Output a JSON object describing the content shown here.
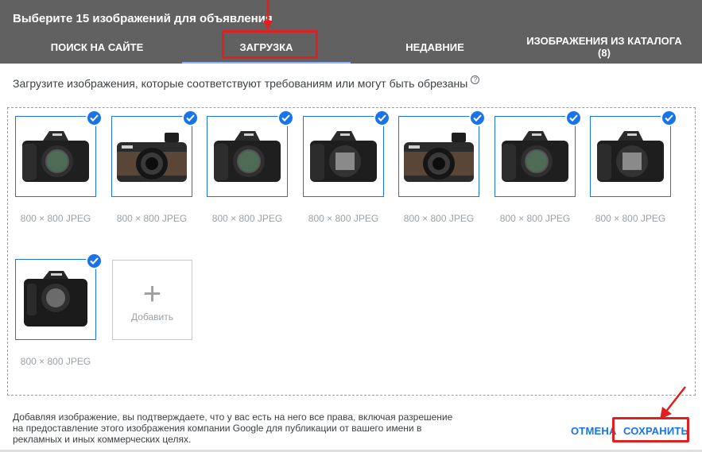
{
  "dialog": {
    "title": "Выберите 15 изображений для объявления"
  },
  "tabs": [
    {
      "label": "ПОИСК НА САЙТЕ"
    },
    {
      "label": "ЗАГРУЗКА",
      "active": true
    },
    {
      "label": "НЕДАВНИЕ"
    },
    {
      "label": "ИЗОБРАЖЕНИЯ ИЗ КАТАЛОГА (8)"
    }
  ],
  "instruction": {
    "text": "Загрузите изображения, которые соответствуют требованиям или могут быть обрезаны",
    "help_icon": "help-circle-icon",
    "help_glyph": "?"
  },
  "images": [
    {
      "caption": "800 × 800 JPEG",
      "kind": "dslr",
      "selected": true
    },
    {
      "caption": "800 × 800 JPEG",
      "kind": "compact",
      "selected": true
    },
    {
      "caption": "800 × 800 JPEG",
      "kind": "dslr",
      "selected": true
    },
    {
      "caption": "800 × 800 JPEG",
      "kind": "dslr-front",
      "selected": true
    },
    {
      "caption": "800 × 800 JPEG",
      "kind": "compact",
      "selected": true
    },
    {
      "caption": "800 × 800 JPEG",
      "kind": "dslr",
      "selected": true
    },
    {
      "caption": "800 × 800 JPEG",
      "kind": "dslr-front",
      "selected": true
    },
    {
      "caption": "800 × 800 JPEG",
      "kind": "pro-dslr",
      "selected": true
    }
  ],
  "add_tile": {
    "plus": "+",
    "label": "Добавить"
  },
  "footer": {
    "disclaimer": "Добавляя изображение, вы подтверждаете, что у вас есть на него все права, включая разрешение на предоставление этого изображения компании Google для публикации от вашего имени в рекламных и иных коммерческих целях.",
    "cancel_label": "ОТМЕНА",
    "save_label": "СОХРАНИТЬ"
  },
  "colors": {
    "header": "#616161",
    "accent": "#1a73e8",
    "annotation": "#e02020"
  }
}
